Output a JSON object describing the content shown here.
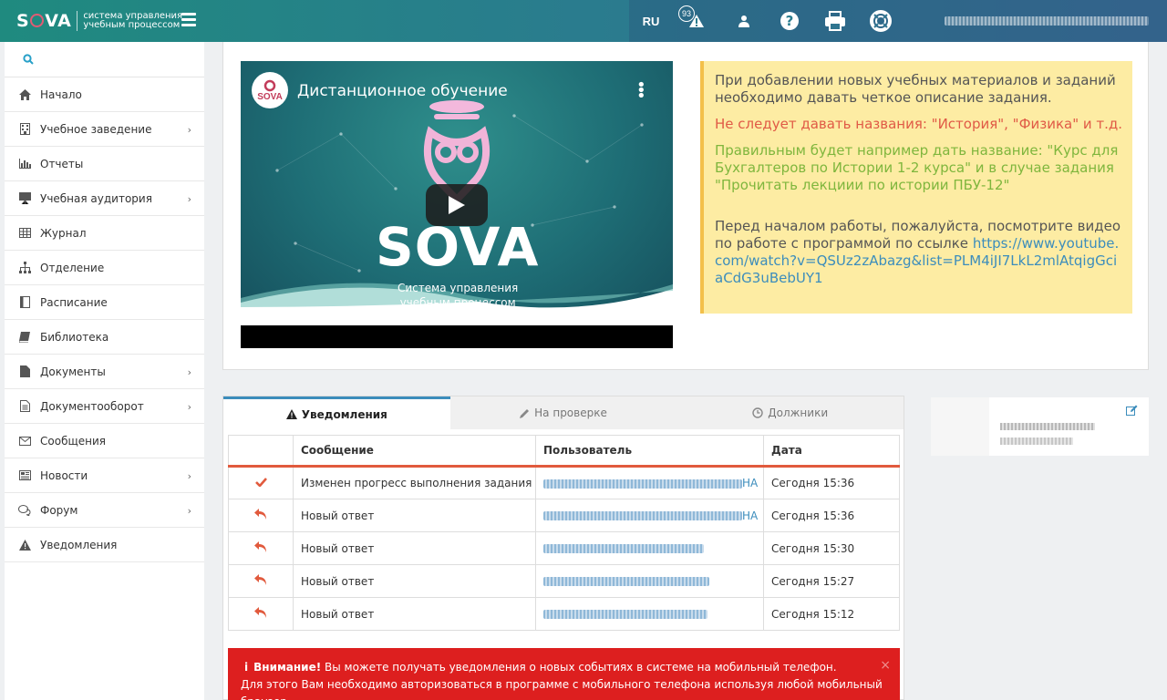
{
  "app": {
    "logo_text_pre": "S",
    "logo_text_post": "VA",
    "logo_sub_line1": "система управления",
    "logo_sub_line2": "учебным процессом"
  },
  "header": {
    "language": "RU",
    "notification_count": "93",
    "icons": [
      "warning-icon",
      "user-icon",
      "help-icon",
      "print-icon",
      "lifebuoy-icon"
    ]
  },
  "sidebar": {
    "items": [
      {
        "label": "Начало",
        "icon": "home-icon",
        "has_children": false
      },
      {
        "label": "Учебное заведение",
        "icon": "building-icon",
        "has_children": true
      },
      {
        "label": "Отчеты",
        "icon": "bar-chart-icon",
        "has_children": false
      },
      {
        "label": "Учебная аудитория",
        "icon": "easel-icon",
        "has_children": true
      },
      {
        "label": "Журнал",
        "icon": "table-icon",
        "has_children": false
      },
      {
        "label": "Отделение",
        "icon": "sitemap-icon",
        "has_children": false
      },
      {
        "label": "Расписание",
        "icon": "calendar-icon",
        "has_children": false
      },
      {
        "label": "Библиотека",
        "icon": "book-icon",
        "has_children": false
      },
      {
        "label": "Документы",
        "icon": "file-icon",
        "has_children": true
      },
      {
        "label": "Документооборот",
        "icon": "file-text-icon",
        "has_children": true
      },
      {
        "label": "Сообщения",
        "icon": "envelope-icon",
        "has_children": false
      },
      {
        "label": "Новости",
        "icon": "newspaper-icon",
        "has_children": true
      },
      {
        "label": "Форум",
        "icon": "comments-icon",
        "has_children": true
      },
      {
        "label": "Уведомления",
        "icon": "warning-icon",
        "has_children": false
      }
    ]
  },
  "video": {
    "title": "Дистанционное обучение",
    "channel_label": "SOVA",
    "brand": "SOVA",
    "subtitle_line1": "Система управления",
    "subtitle_line2": "учебным процессом"
  },
  "info": {
    "p1": "При добавлении новых учебных материалов и заданий необходимо давать четкое описание задания.",
    "p2": "Не следует давать названия: \"История\", \"Физика\" и т.д.",
    "p3": "Правильным будет например дать название: \"Курс для Бухгалтеров по Истории 1-2 курса\" и в случае задания \"Прочитать лекциии по истории ПБУ-12\"",
    "p4_text": "Перед началом работы, пожалуйста, посмотрите видео по работе с программой по ссылке ",
    "p4_link": "https://www.youtube.com/watch?v=QSUz2zAbazg&list=PLM4iJI7LkL2mlAtqigGciaCdG3uBebUY1"
  },
  "tabs": [
    {
      "label": "Уведомления",
      "icon": "warning-icon",
      "active": true
    },
    {
      "label": "На проверке",
      "icon": "pencil-icon",
      "active": false
    },
    {
      "label": "Должники",
      "icon": "clock-icon",
      "active": false
    }
  ],
  "table": {
    "headers": [
      "",
      "Сообщение",
      "Пользователь",
      "Дата"
    ],
    "rows": [
      {
        "icon": "check-icon",
        "message": "Изменен прогресс выполнения задания",
        "user_suffix": "НА",
        "date": "Сегодня 15:36"
      },
      {
        "icon": "reply-icon",
        "message": "Новый ответ",
        "user_suffix": "НА",
        "date": "Сегодня 15:36"
      },
      {
        "icon": "reply-icon",
        "message": "Новый ответ",
        "user_suffix": "",
        "date": "Сегодня 15:30"
      },
      {
        "icon": "reply-icon",
        "message": "Новый ответ",
        "user_suffix": "",
        "date": "Сегодня 15:27"
      },
      {
        "icon": "reply-icon",
        "message": "Новый ответ",
        "user_suffix": "",
        "date": "Сегодня 15:12"
      }
    ]
  },
  "alert": {
    "strong": "Внимание!",
    "line1": " Вы можете получать уведомления о новых событиях в системе на мобильный телефон.",
    "line2": "Для этого Вам необходимо авторизоваться в программе с мобильного телефона используя любой мобильный браузер",
    "close": "×"
  },
  "colors": {
    "accent": "#3c8dbc",
    "alert_red": "#dd1f1f",
    "info_bg": "#fdeca3",
    "check_red": "#e15a3d"
  }
}
